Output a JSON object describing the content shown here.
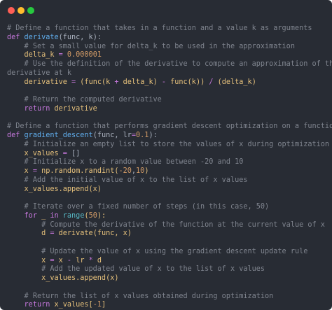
{
  "window": {
    "controls": {
      "close_color": "#ff5f56",
      "minimize_color": "#ffbd2e",
      "maximize_color": "#27c93f"
    }
  },
  "code_lines": [
    [
      {
        "t": "# Define a function that takes in a function and a value k as arguments",
        "c": "comment"
      }
    ],
    [
      {
        "t": "def ",
        "c": "keyword"
      },
      {
        "t": "derivate",
        "c": "func"
      },
      {
        "t": "(func, k):",
        "c": "text"
      }
    ],
    [
      {
        "t": "    ",
        "c": "text"
      },
      {
        "t": "# Set a small value for delta_k to be used in the approximation",
        "c": "comment"
      }
    ],
    [
      {
        "t": "    delta_k ",
        "c": "ident"
      },
      {
        "t": "= ",
        "c": "op"
      },
      {
        "t": "0.000001",
        "c": "number"
      }
    ],
    [
      {
        "t": "    ",
        "c": "text"
      },
      {
        "t": "# Use the definition of the derivative to compute an approximation of the",
        "c": "comment"
      }
    ],
    [
      {
        "t": "derivative at k",
        "c": "comment"
      }
    ],
    [
      {
        "t": "    derivative ",
        "c": "ident"
      },
      {
        "t": "= ",
        "c": "op"
      },
      {
        "t": "(func(k ",
        "c": "ident"
      },
      {
        "t": "+ ",
        "c": "op"
      },
      {
        "t": "delta_k) ",
        "c": "ident"
      },
      {
        "t": "- ",
        "c": "op"
      },
      {
        "t": "func(k)) ",
        "c": "ident"
      },
      {
        "t": "/ ",
        "c": "op"
      },
      {
        "t": "(delta_k)",
        "c": "ident"
      }
    ],
    [
      {
        "t": "",
        "c": "text"
      }
    ],
    [
      {
        "t": "    ",
        "c": "text"
      },
      {
        "t": "# Return the computed derivative",
        "c": "comment"
      }
    ],
    [
      {
        "t": "    ",
        "c": "text"
      },
      {
        "t": "return ",
        "c": "keyword"
      },
      {
        "t": "derivative",
        "c": "ident"
      }
    ],
    [
      {
        "t": "",
        "c": "text"
      }
    ],
    [
      {
        "t": "# Define a function that performs gradient descent optimization on a function",
        "c": "comment"
      }
    ],
    [
      {
        "t": "def ",
        "c": "keyword"
      },
      {
        "t": "gradient_descent",
        "c": "func"
      },
      {
        "t": "(func, lr",
        "c": "text"
      },
      {
        "t": "=",
        "c": "op"
      },
      {
        "t": "0.1",
        "c": "number"
      },
      {
        "t": "):",
        "c": "text"
      }
    ],
    [
      {
        "t": "    ",
        "c": "text"
      },
      {
        "t": "# Initialize an empty list to store the values of x during optimization",
        "c": "comment"
      }
    ],
    [
      {
        "t": "    x_values ",
        "c": "ident"
      },
      {
        "t": "= ",
        "c": "op"
      },
      {
        "t": "[]",
        "c": "text"
      }
    ],
    [
      {
        "t": "    ",
        "c": "text"
      },
      {
        "t": "# Initialize x to a random value between -20 and 10",
        "c": "comment"
      }
    ],
    [
      {
        "t": "    x ",
        "c": "ident"
      },
      {
        "t": "= ",
        "c": "op"
      },
      {
        "t": "np.random.randint(",
        "c": "ident"
      },
      {
        "t": "-20",
        "c": "number"
      },
      {
        "t": ",",
        "c": "text"
      },
      {
        "t": "10",
        "c": "number"
      },
      {
        "t": ")",
        "c": "ident"
      }
    ],
    [
      {
        "t": "    ",
        "c": "text"
      },
      {
        "t": "# Add the initial value of x to the list of x values",
        "c": "comment"
      }
    ],
    [
      {
        "t": "    x_values.append(x)",
        "c": "ident"
      }
    ],
    [
      {
        "t": "",
        "c": "text"
      }
    ],
    [
      {
        "t": "    ",
        "c": "text"
      },
      {
        "t": "# Iterate over a fixed number of steps (in this case, 50)",
        "c": "comment"
      }
    ],
    [
      {
        "t": "    ",
        "c": "text"
      },
      {
        "t": "for ",
        "c": "keyword"
      },
      {
        "t": "_ ",
        "c": "ident"
      },
      {
        "t": "in ",
        "c": "keyword"
      },
      {
        "t": "range",
        "c": "builtin"
      },
      {
        "t": "(",
        "c": "ident"
      },
      {
        "t": "50",
        "c": "number"
      },
      {
        "t": "):",
        "c": "ident"
      }
    ],
    [
      {
        "t": "        ",
        "c": "text"
      },
      {
        "t": "# Compute the derivative of the function at the current value of x",
        "c": "comment"
      }
    ],
    [
      {
        "t": "        d ",
        "c": "ident"
      },
      {
        "t": "= ",
        "c": "op"
      },
      {
        "t": "derivate(func, x)",
        "c": "ident"
      }
    ],
    [
      {
        "t": "",
        "c": "text"
      }
    ],
    [
      {
        "t": "        ",
        "c": "text"
      },
      {
        "t": "# Update the value of x using the gradient descent update rule",
        "c": "comment"
      }
    ],
    [
      {
        "t": "        x ",
        "c": "ident"
      },
      {
        "t": "= ",
        "c": "op"
      },
      {
        "t": "x ",
        "c": "ident"
      },
      {
        "t": "- ",
        "c": "op"
      },
      {
        "t": "lr ",
        "c": "ident"
      },
      {
        "t": "* ",
        "c": "op"
      },
      {
        "t": "d",
        "c": "ident"
      }
    ],
    [
      {
        "t": "        ",
        "c": "text"
      },
      {
        "t": "# Add the updated value of x to the list of x values",
        "c": "comment"
      }
    ],
    [
      {
        "t": "        x_values.append(x)",
        "c": "ident"
      }
    ],
    [
      {
        "t": "",
        "c": "text"
      }
    ],
    [
      {
        "t": "    ",
        "c": "text"
      },
      {
        "t": "# Return the list of x values obtained during optimization",
        "c": "comment"
      }
    ],
    [
      {
        "t": "    ",
        "c": "text"
      },
      {
        "t": "return ",
        "c": "keyword"
      },
      {
        "t": "x_values[",
        "c": "ident"
      },
      {
        "t": "-1",
        "c": "number"
      },
      {
        "t": "]",
        "c": "ident"
      }
    ]
  ]
}
